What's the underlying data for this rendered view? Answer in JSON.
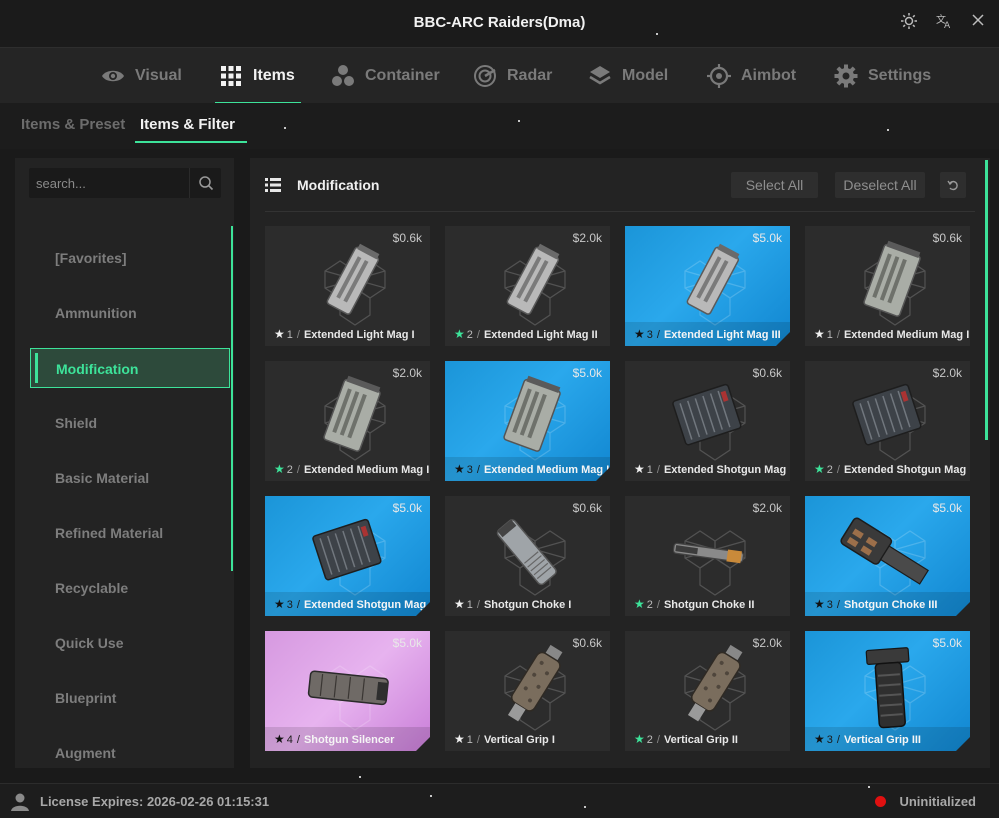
{
  "app": {
    "title": "BBC-ARC Raiders(Dma)"
  },
  "nav": {
    "tabs": [
      {
        "label": "Visual",
        "icon": "eye-icon",
        "active": false
      },
      {
        "label": "Items",
        "icon": "grid-icon",
        "active": true
      },
      {
        "label": "Container",
        "icon": "cubes-icon",
        "active": false
      },
      {
        "label": "Radar",
        "icon": "radar-icon",
        "active": false
      },
      {
        "label": "Model",
        "icon": "layers-icon",
        "active": false
      },
      {
        "label": "Aimbot",
        "icon": "crosshair-icon",
        "active": false
      },
      {
        "label": "Settings",
        "icon": "gear-icon",
        "active": false
      }
    ]
  },
  "subtabs": [
    {
      "label": "Items & Preset",
      "active": false
    },
    {
      "label": "Items & Filter",
      "active": true
    }
  ],
  "sidebar": {
    "search_placeholder": "search...",
    "items": [
      {
        "label": "[Favorites]"
      },
      {
        "label": "Ammunition"
      },
      {
        "label": "Modification",
        "active": true
      },
      {
        "label": "Shield"
      },
      {
        "label": "Basic Material"
      },
      {
        "label": "Refined Material"
      },
      {
        "label": "Recyclable"
      },
      {
        "label": "Quick Use"
      },
      {
        "label": "Blueprint"
      },
      {
        "label": "Augment"
      }
    ]
  },
  "panel": {
    "title": "Modification",
    "select_all": "Select All",
    "deselect_all": "Deselect All",
    "undo_icon": "undo-icon"
  },
  "items": [
    {
      "name": "Extended Light Mag I",
      "tier": "1",
      "price": "$0.6k",
      "rarity": "common",
      "star": "white",
      "art": "mag-light"
    },
    {
      "name": "Extended Light Mag II",
      "tier": "2",
      "price": "$2.0k",
      "rarity": "uncommon",
      "star": "green",
      "art": "mag-light"
    },
    {
      "name": "Extended Light Mag III",
      "tier": "3",
      "price": "$5.0k",
      "rarity": "rare",
      "star": "black",
      "art": "mag-light"
    },
    {
      "name": "Extended Medium Mag I",
      "tier": "1",
      "price": "$0.6k",
      "rarity": "common",
      "star": "white",
      "art": "mag-medium"
    },
    {
      "name": "Extended Medium Mag II",
      "tier": "2",
      "price": "$2.0k",
      "rarity": "uncommon",
      "star": "green",
      "art": "mag-medium"
    },
    {
      "name": "Extended Medium Mag III",
      "tier": "3",
      "price": "$5.0k",
      "rarity": "rare",
      "star": "black",
      "art": "mag-medium"
    },
    {
      "name": "Extended Shotgun Mag I",
      "tier": "1",
      "price": "$0.6k",
      "rarity": "common",
      "star": "white",
      "art": "mag-shotgun"
    },
    {
      "name": "Extended Shotgun Mag II",
      "tier": "2",
      "price": "$2.0k",
      "rarity": "uncommon",
      "star": "green",
      "art": "mag-shotgun"
    },
    {
      "name": "Extended Shotgun Mag III",
      "tier": "3",
      "price": "$5.0k",
      "rarity": "rare",
      "star": "black",
      "art": "mag-shotgun"
    },
    {
      "name": "Shotgun Choke I",
      "tier": "1",
      "price": "$0.6k",
      "rarity": "common",
      "star": "white",
      "art": "choke-1"
    },
    {
      "name": "Shotgun Choke II",
      "tier": "2",
      "price": "$2.0k",
      "rarity": "uncommon",
      "star": "green",
      "art": "choke-2"
    },
    {
      "name": "Shotgun Choke III",
      "tier": "3",
      "price": "$5.0k",
      "rarity": "rare",
      "star": "black",
      "art": "choke-3"
    },
    {
      "name": "Shotgun Silencer",
      "tier": "4",
      "price": "$5.0k",
      "rarity": "epic",
      "star": "black",
      "art": "silencer"
    },
    {
      "name": "Vertical Grip I",
      "tier": "1",
      "price": "$0.6k",
      "rarity": "common",
      "star": "white",
      "art": "grip"
    },
    {
      "name": "Vertical Grip II",
      "tier": "2",
      "price": "$2.0k",
      "rarity": "uncommon",
      "star": "green",
      "art": "grip"
    },
    {
      "name": "Vertical Grip III",
      "tier": "3",
      "price": "$5.0k",
      "rarity": "rare",
      "star": "black",
      "art": "grip-3"
    }
  ],
  "status": {
    "license": "License Expires: 2026-02-26  01:15:31",
    "state": "Uninitialized",
    "state_color": "#e01010"
  },
  "colors": {
    "accent": "#3de39a",
    "rare": "#1b95d8",
    "epic": "#d699e0",
    "uncommon_star": "#3de39a"
  }
}
